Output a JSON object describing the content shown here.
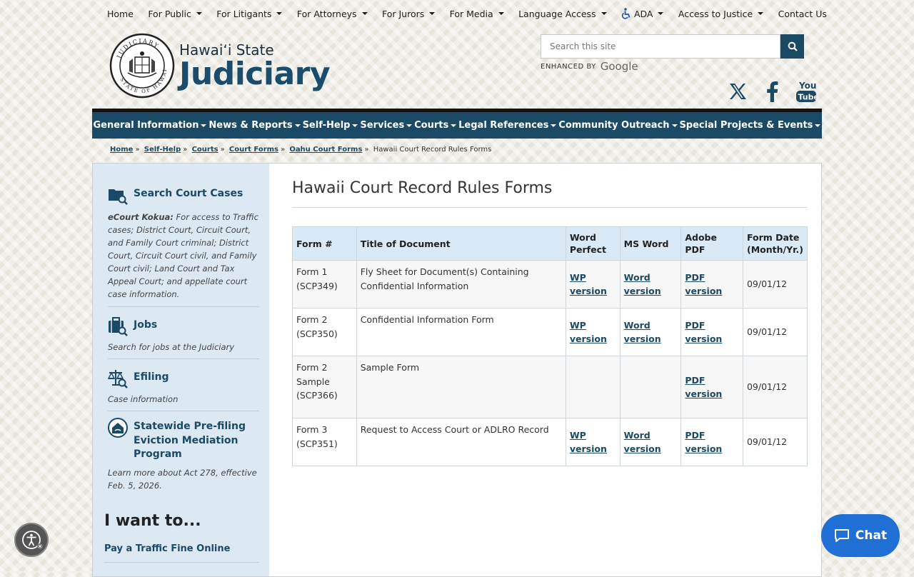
{
  "topnav": [
    {
      "label": "Home",
      "dropdown": false
    },
    {
      "label": "For Public",
      "dropdown": true
    },
    {
      "label": "For Litigants",
      "dropdown": true
    },
    {
      "label": "For Attorneys",
      "dropdown": true
    },
    {
      "label": "For Jurors",
      "dropdown": true
    },
    {
      "label": "For Media",
      "dropdown": true
    },
    {
      "label": "Language Access",
      "dropdown": true
    },
    {
      "label": "ADA",
      "dropdown": true
    },
    {
      "label": "Access to Justice",
      "dropdown": true
    },
    {
      "label": "Contact Us",
      "dropdown": false
    }
  ],
  "logo": {
    "line1": "Hawaiʻi State",
    "line2": "Judiciary",
    "seal_top": "JUDICIARY",
    "seal_bottom": "STATE OF HAWAII"
  },
  "search": {
    "placeholder": "Search this site",
    "enhanced": "ENHANCED BY",
    "google": "Google"
  },
  "social": [
    "x-icon",
    "facebook-icon",
    "youtube-icon"
  ],
  "mainnav": [
    "General Information",
    "News & Reports",
    "Self-Help",
    "Services",
    "Courts",
    "Legal References",
    "Community Outreach",
    "Special Projects & Events"
  ],
  "breadcrumb": {
    "links": [
      "Home",
      "Self-Help",
      "Courts",
      "Court Forms",
      "Oahu Court Forms"
    ],
    "current": "Hawaii Court Record Rules Forms",
    "separator": "»"
  },
  "sidebar": {
    "search_cases": {
      "title": "Search Court Cases",
      "desc_bold": "eCourt Kokua:",
      "desc": " For access to Traffic cases; District Court, Circuit Court, and Family Court criminal; District Court, Circuit Court civil, and Family Court civil; Land Court and Tax Appeal Court; and appellate court case information."
    },
    "jobs": {
      "title": "Jobs",
      "desc": "Search for jobs at the Judiciary"
    },
    "efiling": {
      "title": "Efiling",
      "desc": "Case information"
    },
    "eviction": {
      "title": "Statewide Pre-filing Eviction Mediation Program",
      "desc": "Learn more about Act 278, effective Feb. 5, 2026."
    },
    "iwant": "I want to...",
    "pay": "Pay a Traffic Fine Online"
  },
  "page_title": "Hawaii Court Record Rules Forms",
  "table": {
    "headers": [
      "Form #",
      "Title of Document",
      "Word Perfect",
      "MS Word",
      "Adobe PDF",
      "Form Date (Month/Yr.)"
    ],
    "rows": [
      {
        "form": "Form 1 (SCP349)",
        "title": "Fly Sheet for Document(s) Containing Confidential Information",
        "wp": "WP version",
        "word": "Word version",
        "pdf": "PDF version",
        "date": "09/01/12"
      },
      {
        "form": "Form 2 (SCP350)",
        "title": "Confidential Information Form",
        "wp": "WP version",
        "word": "Word version",
        "pdf": "PDF version",
        "date": "09/01/12"
      },
      {
        "form": "Form 2 Sample (SCP366)",
        "title": "Sample Form",
        "wp": "",
        "word": "",
        "pdf": "PDF version",
        "date": "09/01/12"
      },
      {
        "form": "Form 3 (SCP351)",
        "title": "Request to Access Court or ADLRO Record",
        "wp": "WP version",
        "word": "Word version",
        "pdf": "PDF version",
        "date": "09/01/12"
      }
    ]
  },
  "chat": {
    "label": "Chat"
  },
  "colors": {
    "brand": "#1a4a66",
    "table_header": "#d9e9f5",
    "sidebar": "#dce8f2",
    "chat": "#1f6fd4"
  }
}
